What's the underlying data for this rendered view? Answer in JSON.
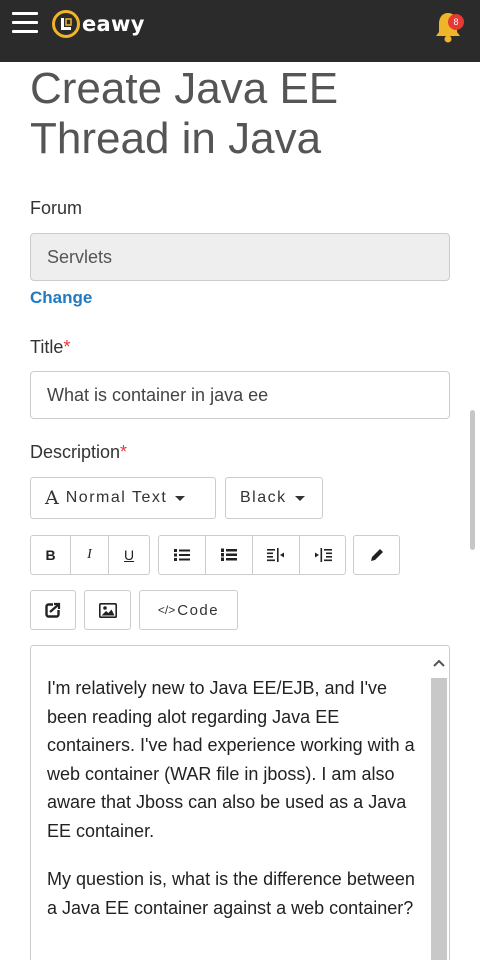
{
  "header": {
    "logo_text": "eawy",
    "logo_letter": "L",
    "notification_count": "8",
    "colors": {
      "bar": "#2b2b2b",
      "accent": "#f0b429",
      "badge": "#e53935"
    }
  },
  "page": {
    "title": "Create Java EE Thread in Java"
  },
  "form": {
    "forum_label": "Forum",
    "forum_value": "Servlets",
    "change_link": "Change",
    "title_label": "Title",
    "title_required": "*",
    "title_value": "What is container in java ee",
    "description_label": "Description",
    "description_required": "*"
  },
  "toolbar": {
    "text_style_glyph": "A",
    "text_style": "Normal Text",
    "text_color": "Black",
    "bold": "B",
    "italic": "I",
    "underline": "U",
    "code": "Code",
    "code_glyph": "</>",
    "icons": [
      "bullet-list-icon",
      "numbered-list-icon",
      "outdent-icon",
      "indent-icon",
      "pencil-icon",
      "embed-icon",
      "image-icon"
    ]
  },
  "editor": {
    "paragraphs": [
      "I'm relatively new to Java EE/EJB, and I've been reading alot regarding Java EE containers. I've had experience working with a web container (WAR file in jboss). I am also aware that Jboss can also be used as a Java EE container.",
      "My question is, what is the difference between a Java EE container against a web container?"
    ]
  }
}
